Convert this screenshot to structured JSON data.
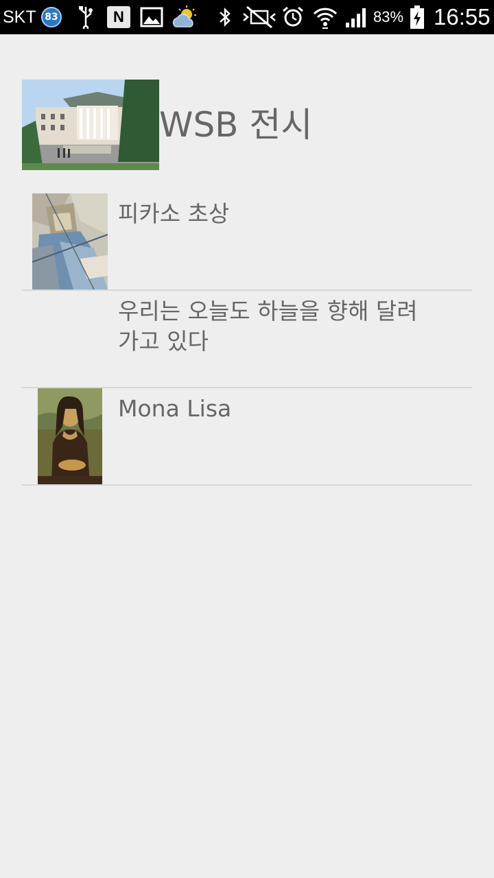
{
  "status_bar": {
    "carrier": "SKT",
    "notification_badge": "83",
    "battery_percent": "83%",
    "time": "16:55",
    "icons": [
      "usb-icon",
      "n-app-icon",
      "gallery-icon",
      "weather-icon",
      "bluetooth-icon",
      "vibrate-mute-icon",
      "alarm-icon",
      "wifi-icon",
      "signal-icon",
      "battery-charging-icon"
    ]
  },
  "header": {
    "title": "WSB 전시",
    "thumbnail": "campus-building-photo"
  },
  "list": {
    "items": [
      {
        "title": "피카소 초상",
        "thumbnail": "picasso-portrait-painting"
      },
      {
        "title": "우리는 오늘도 하늘을 향해 달려가고 있다",
        "thumbnail": ""
      },
      {
        "title": "Mona Lisa",
        "thumbnail": "mona-lisa-painting"
      }
    ]
  }
}
